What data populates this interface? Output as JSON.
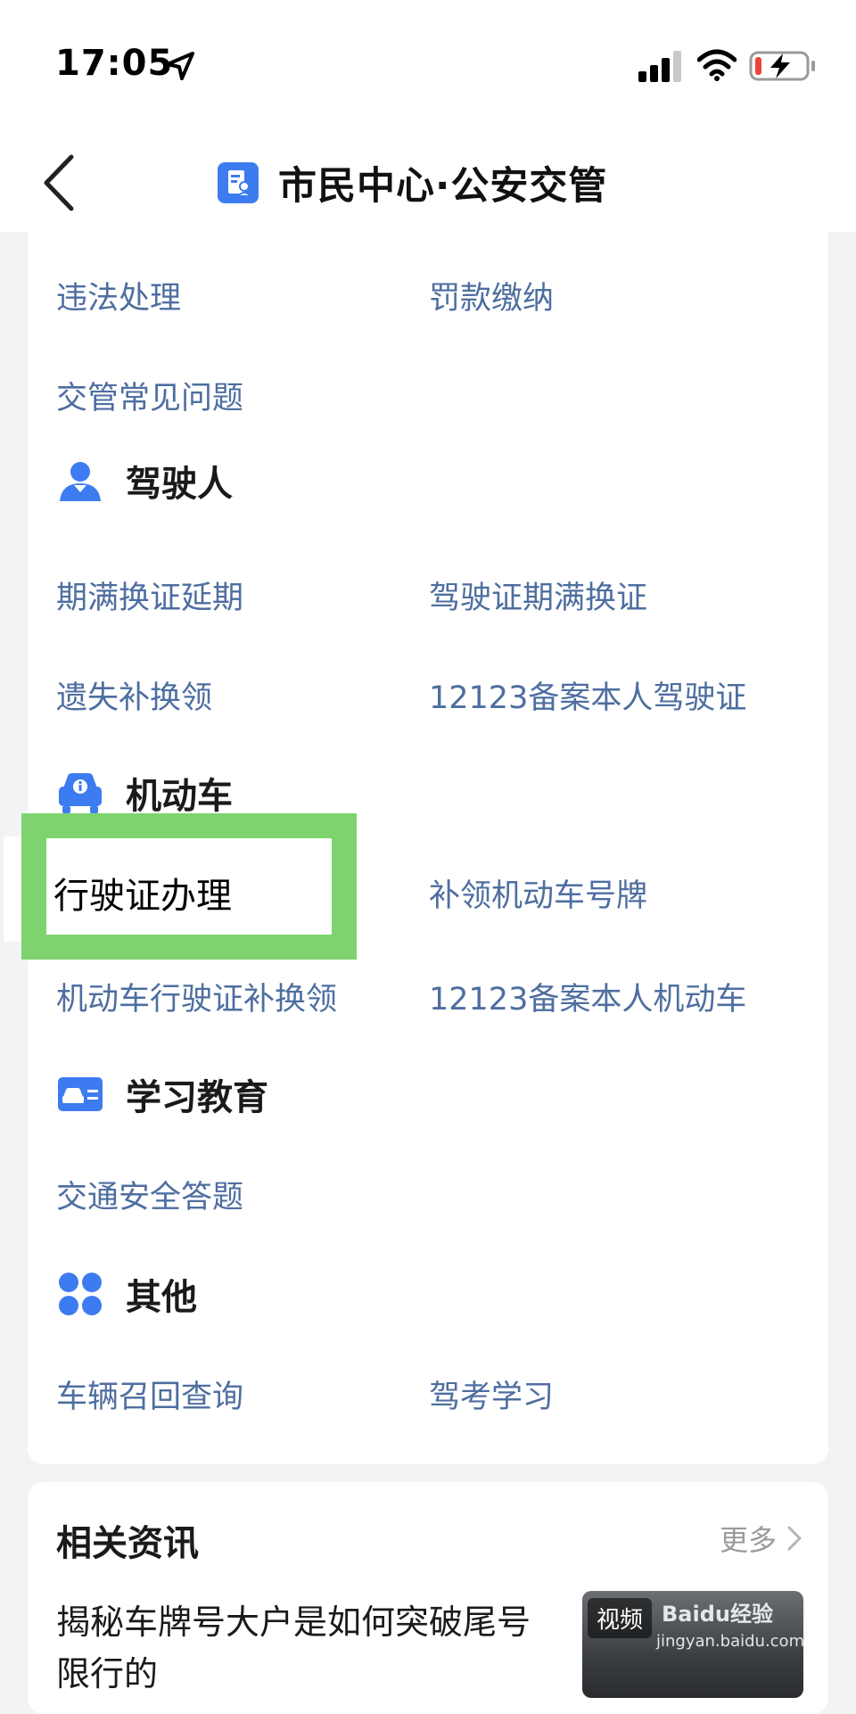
{
  "status_bar": {
    "time": "17:05",
    "icons": [
      "location-arrow-icon",
      "cellular-signal-icon",
      "wifi-icon",
      "battery-charging-icon"
    ]
  },
  "nav": {
    "title": "市民中心·公安交管",
    "back_icon": "chevron-left-icon",
    "title_icon": "document-person-icon"
  },
  "colors": {
    "link": "#4e6ea0",
    "accent": "#3d7cf0",
    "highlight": "#7fd36e"
  },
  "sections": {
    "top_links": [
      "违法处理",
      "罚款缴纳",
      "交管常见问题"
    ],
    "driver": {
      "title": "驾驶人",
      "icon": "driver-person-icon",
      "links": [
        "期满换证延期",
        "驾驶证期满换证",
        "遗失补换领",
        "12123备案本人驾驶证"
      ]
    },
    "vehicle": {
      "title": "机动车",
      "icon": "car-info-icon",
      "links": [
        "行驶证办理",
        "补领机动车号牌",
        "机动车行驶证补换领",
        "12123备案本人机动车"
      ]
    },
    "education": {
      "title": "学习教育",
      "icon": "car-card-icon",
      "links": [
        "交通安全答题"
      ]
    },
    "other": {
      "title": "其他",
      "icon": "four-dots-grid-icon",
      "links": [
        "车辆召回查询",
        "驾考学习"
      ]
    }
  },
  "news": {
    "title": "相关资讯",
    "more": "更多",
    "item_title": "揭秘车牌号大户是如何突破尾号限行的",
    "thumb_badge": "视频"
  },
  "watermark": {
    "brand": "Baidu经验",
    "url": "jingyan.baidu.com"
  }
}
